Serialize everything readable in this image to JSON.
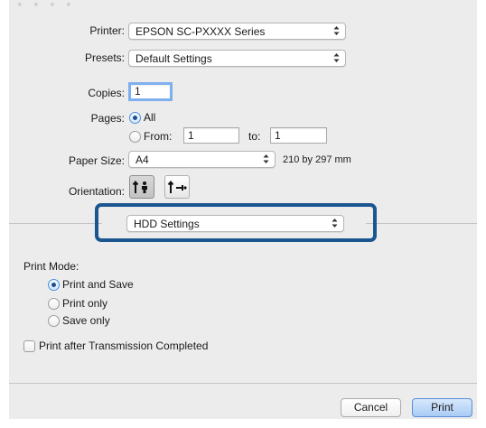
{
  "printer": {
    "label": "Printer:",
    "value": "EPSON SC-PXXXX Series"
  },
  "presets": {
    "label": "Presets:",
    "value": "Default Settings"
  },
  "copies": {
    "label": "Copies:",
    "value": "1"
  },
  "pages": {
    "label": "Pages:",
    "all_label": "All",
    "from_label": "From:",
    "from_value": "1",
    "to_label": "to:",
    "to_value": "1",
    "selected": "All"
  },
  "paper_size": {
    "label": "Paper Size:",
    "value": "A4",
    "dimensions": "210 by 297 mm"
  },
  "orientation": {
    "label": "Orientation:",
    "selected": "portrait",
    "icons": [
      "portrait-orientation-icon",
      "landscape-orientation-icon"
    ]
  },
  "section_menu": {
    "value": "HDD Settings"
  },
  "print_mode": {
    "label": "Print Mode:",
    "options": [
      "Print and Save",
      "Print only",
      "Save only"
    ],
    "selected": "Print and Save"
  },
  "print_after_transmission": {
    "label": "Print after Transmission Completed",
    "checked": false
  },
  "buttons": {
    "cancel": "Cancel",
    "print": "Print"
  },
  "colors": {
    "highlight": "#1b5690",
    "dialog_bg": "#ececec",
    "default_button": "#a9cbf5"
  }
}
